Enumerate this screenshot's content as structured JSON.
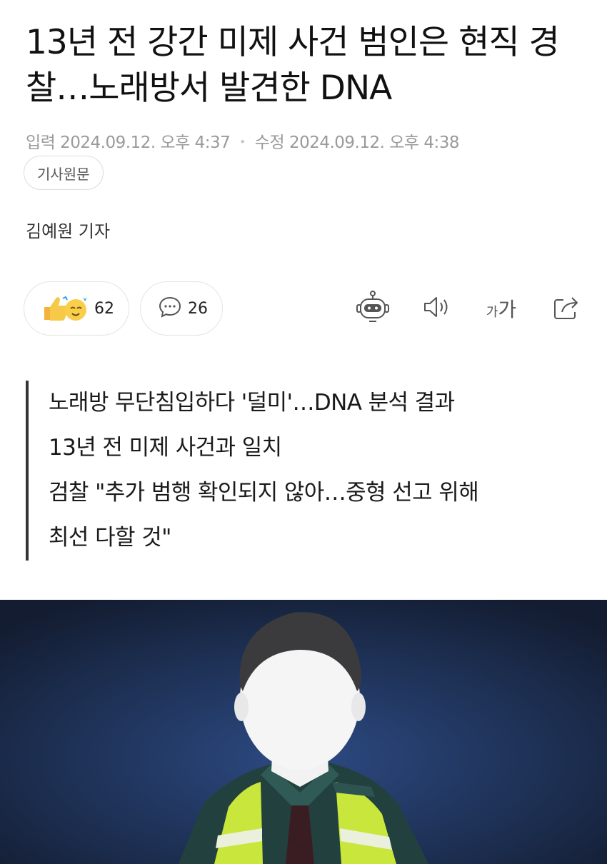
{
  "article": {
    "title": "13년 전 강간 미제 사건 범인은 현직 경찰…노래방서 발견한 DNA",
    "input_label": "입력",
    "input_time": "2024.09.12. 오후 4:37",
    "edit_label": "수정",
    "edit_time": "2024.09.12. 오후 4:38",
    "original_button": "기사원문",
    "reporter": "김예원 기자"
  },
  "reactions": {
    "like_count": "62",
    "comment_count": "26"
  },
  "toolbar": {
    "icons": [
      "robot-summary-icon",
      "speaker-icon",
      "font-size-icon",
      "share-icon"
    ],
    "font_size_small": "가",
    "font_size_large": "가"
  },
  "summary": {
    "lines": [
      "노래방 무단침입하다 '덜미'…DNA 분석 결과",
      "13년 전 미제 사건과 일치",
      "검찰 \"추가 범행 확인되지 않아…중형 선고 위해",
      "최선 다할 것\""
    ]
  },
  "colors": {
    "text": "#111111",
    "meta": "#9a9a9a",
    "hero_background": "#1b2a44",
    "vest": "#c8e63c"
  }
}
